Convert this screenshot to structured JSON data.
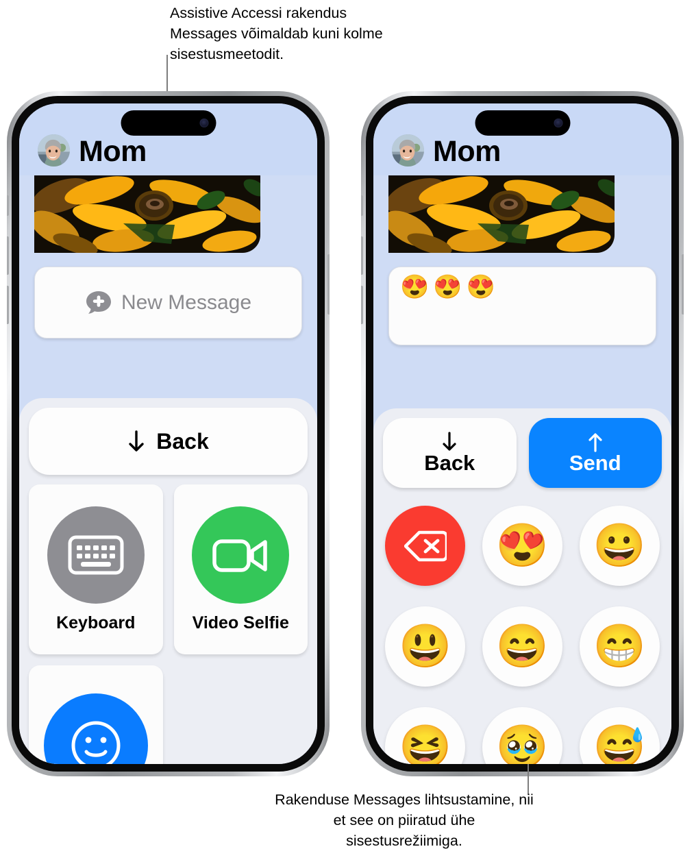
{
  "captions": {
    "top": "Assistive Accessi rakendus Messages võimaldab kuni kolme sisestusmeetodit.",
    "bottom": "Rakenduse Messages lihtsustamine, nii et see on piiratud ühe sisestusrežiimiga."
  },
  "colors": {
    "screen_background": "#cfdcf5",
    "header_background": "#c9d9f6",
    "panel_background": "#eceef4",
    "send_blue": "#0a84ff",
    "delete_red": "#fa3b30",
    "keyboard_gray": "#8e8e93",
    "video_green": "#34c759",
    "emoji_blue": "#0a7cff"
  },
  "phones": [
    {
      "id": "phone-left",
      "header": {
        "contact_name": "Mom",
        "avatar_icon": "contact-avatar-photo"
      },
      "conversation": {
        "photo_message": "sunflower-photo-bubble",
        "composer": {
          "placeholder": "New Message",
          "icon": "new-message-bubble-plus-icon",
          "value": ""
        }
      },
      "controls": {
        "back": {
          "label": "Back",
          "icon": "arrow-down-icon"
        },
        "tiles": [
          {
            "label": "Keyboard",
            "icon": "keyboard-icon",
            "color": "#8e8e93"
          },
          {
            "label": "Video Selfie",
            "icon": "video-camera-icon",
            "color": "#34c759"
          },
          {
            "label": "",
            "icon": "smiley-face-icon",
            "color": "#0a7cff"
          }
        ]
      }
    },
    {
      "id": "phone-right",
      "header": {
        "contact_name": "Mom",
        "avatar_icon": "contact-avatar-photo"
      },
      "conversation": {
        "photo_message": "sunflower-photo-bubble",
        "composer": {
          "placeholder": "",
          "icon": "",
          "value": "😍😍😍"
        }
      },
      "controls": {
        "back": {
          "label": "Back",
          "icon": "arrow-down-icon"
        },
        "send": {
          "label": "Send",
          "icon": "arrow-up-icon"
        },
        "keypad": [
          {
            "name": "delete-key",
            "glyph": "",
            "kind": "delete"
          },
          {
            "name": "emoji-key-heart-eyes",
            "glyph": "😍",
            "kind": "emoji"
          },
          {
            "name": "emoji-key-grinning",
            "glyph": "😀",
            "kind": "emoji"
          },
          {
            "name": "emoji-key-smiley",
            "glyph": "😃",
            "kind": "emoji"
          },
          {
            "name": "emoji-key-smile",
            "glyph": "😄",
            "kind": "emoji"
          },
          {
            "name": "emoji-key-grin",
            "glyph": "😁",
            "kind": "emoji"
          },
          {
            "name": "emoji-key-squinting",
            "glyph": "😆",
            "kind": "emoji"
          },
          {
            "name": "emoji-key-holding-back-tears",
            "glyph": "🥹",
            "kind": "emoji"
          },
          {
            "name": "emoji-key-sweat-smile",
            "glyph": "😅",
            "kind": "emoji"
          }
        ]
      }
    }
  ]
}
